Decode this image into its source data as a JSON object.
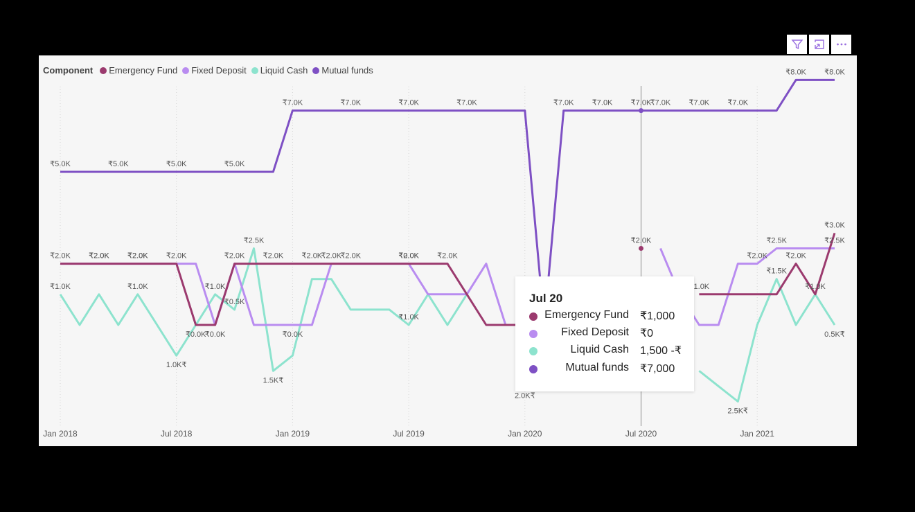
{
  "toolbar": {
    "icons": [
      "filter-icon",
      "focus-mode-icon",
      "more-options-icon"
    ]
  },
  "legend": {
    "title": "Component"
  },
  "tooltip": {
    "title": "Jul 20",
    "rows": [
      {
        "name": "Emergency Fund",
        "value": "₹1,000",
        "color": "#9b3a6e"
      },
      {
        "name": "Fixed Deposit",
        "value": "₹0",
        "color": "#b98cf0"
      },
      {
        "name": "Liquid Cash",
        "value": "1,500 -₹",
        "color": "#8de3ce"
      },
      {
        "name": "Mutual funds",
        "value": "₹7,000",
        "color": "#7e50c4"
      }
    ]
  },
  "chart_data": {
    "type": "line",
    "x_ticks": [
      "Jan 2018",
      "Jul 2018",
      "Jan 2019",
      "Jul 2019",
      "Jan 2020",
      "Jul 2020",
      "Jan 2021"
    ],
    "x_start": "2018-01",
    "x_end": "2021-01",
    "legend_position": "top-left",
    "grid": "vertical dotted",
    "crosshair": "Jul 2020",
    "series": [
      {
        "name": "Emergency Fund",
        "color": "#9b3a6e",
        "values": [
          2000,
          2000,
          2000,
          2000,
          2000,
          2000,
          2000,
          0,
          0,
          2000,
          2000,
          2000,
          2000,
          2000,
          2000,
          2000,
          2000,
          2000,
          2000,
          2000,
          2000,
          1000,
          0,
          0,
          0,
          null,
          null,
          null,
          null,
          null,
          2500,
          null,
          null,
          1000,
          1000,
          1000,
          1000,
          1000,
          2000,
          1000,
          3000
        ]
      },
      {
        "name": "Fixed Deposit",
        "color": "#b98cf0",
        "values": [
          2000,
          2000,
          2000,
          2000,
          2000,
          2000,
          2000,
          2000,
          0,
          2000,
          0,
          0,
          0,
          0,
          2000,
          2000,
          2000,
          2000,
          2000,
          1000,
          1000,
          1000,
          2000,
          0,
          0,
          null,
          null,
          null,
          null,
          null,
          null,
          2500,
          1000,
          0,
          0,
          2000,
          2000,
          2500,
          2500,
          2500,
          2500
        ]
      },
      {
        "name": "Liquid Cash",
        "color": "#8de3ce",
        "values": [
          1000,
          0,
          1000,
          0,
          1000,
          0,
          -1000,
          0,
          1000,
          500,
          2500,
          -1500,
          -1000,
          1500,
          1500,
          500,
          500,
          500,
          0,
          1000,
          0,
          1000,
          null,
          null,
          -2000,
          null,
          null,
          null,
          null,
          null,
          null,
          null,
          null,
          -1500,
          -2000,
          -2500,
          0,
          1500,
          0,
          1000,
          0
        ]
      },
      {
        "name": "Mutual funds",
        "color": "#7e50c4",
        "values": [
          5000,
          5000,
          5000,
          5000,
          5000,
          5000,
          5000,
          5000,
          5000,
          5000,
          5000,
          5000,
          7000,
          7000,
          7000,
          7000,
          7000,
          7000,
          7000,
          7000,
          7000,
          7000,
          7000,
          7000,
          7000,
          0,
          7000,
          7000,
          7000,
          7000,
          7000,
          7000,
          7000,
          7000,
          7000,
          7000,
          7000,
          7000,
          8000,
          8000,
          8000
        ]
      }
    ],
    "data_labels": [
      {
        "series": 0,
        "i": 0,
        "text": "₹2.0K"
      },
      {
        "series": 0,
        "i": 2,
        "text": "₹2.0K"
      },
      {
        "series": 0,
        "i": 4,
        "text": "₹2.0K"
      },
      {
        "series": 0,
        "i": 6,
        "text": "₹2.0K"
      },
      {
        "series": 0,
        "i": 7,
        "text": "₹0.0K"
      },
      {
        "series": 0,
        "i": 9,
        "text": "₹2.0K"
      },
      {
        "series": 0,
        "i": 11,
        "text": "₹2.0K"
      },
      {
        "series": 0,
        "i": 13,
        "text": "₹2.0K"
      },
      {
        "series": 0,
        "i": 15,
        "text": "₹2.0K"
      },
      {
        "series": 0,
        "i": 18,
        "text": "₹2.0K"
      },
      {
        "series": 0,
        "i": 20,
        "text": "₹2.0K"
      },
      {
        "series": 0,
        "i": 30,
        "text": "₹2.0K"
      },
      {
        "series": 0,
        "i": 31,
        "text": "₹2.0K"
      },
      {
        "series": 0,
        "i": 33,
        "text": "₹1.0K"
      },
      {
        "series": 0,
        "i": 38,
        "text": "₹2.0K"
      },
      {
        "series": 0,
        "i": 39,
        "text": "₹1.0K"
      },
      {
        "series": 0,
        "i": 40,
        "text": "₹3.0K"
      },
      {
        "series": 1,
        "i": 2,
        "text": "₹2.0K"
      },
      {
        "series": 1,
        "i": 4,
        "text": "₹2.0K"
      },
      {
        "series": 1,
        "i": 8,
        "text": "₹0.0K"
      },
      {
        "series": 1,
        "i": 12,
        "text": "₹0.0K"
      },
      {
        "series": 1,
        "i": 14,
        "text": "₹2.0K"
      },
      {
        "series": 1,
        "i": 18,
        "text": "₹0.0K"
      },
      {
        "series": 1,
        "i": 36,
        "text": "₹2.0K"
      },
      {
        "series": 1,
        "i": 37,
        "text": "₹2.5K"
      },
      {
        "series": 1,
        "i": 40,
        "text": "₹2.5K"
      },
      {
        "series": 2,
        "i": 0,
        "text": "₹1.0K"
      },
      {
        "series": 2,
        "i": 4,
        "text": "₹1.0K"
      },
      {
        "series": 2,
        "i": 6,
        "text": "1.0K₹"
      },
      {
        "series": 2,
        "i": 8,
        "text": "₹1.0K"
      },
      {
        "series": 2,
        "i": 9,
        "text": "₹0.5K"
      },
      {
        "series": 2,
        "i": 10,
        "text": "₹2.5K"
      },
      {
        "series": 2,
        "i": 11,
        "text": "1.5K₹"
      },
      {
        "series": 2,
        "i": 18,
        "text": "₹1.0K"
      },
      {
        "series": 2,
        "i": 24,
        "text": "2.0K₹"
      },
      {
        "series": 2,
        "i": 35,
        "text": "2.5K₹"
      },
      {
        "series": 2,
        "i": 37,
        "text": "₹1.5K"
      },
      {
        "series": 2,
        "i": 40,
        "text": "0.5K₹"
      },
      {
        "series": 3,
        "i": 0,
        "text": "₹5.0K"
      },
      {
        "series": 3,
        "i": 3,
        "text": "₹5.0K"
      },
      {
        "series": 3,
        "i": 6,
        "text": "₹5.0K"
      },
      {
        "series": 3,
        "i": 9,
        "text": "₹5.0K"
      },
      {
        "series": 3,
        "i": 12,
        "text": "₹7.0K"
      },
      {
        "series": 3,
        "i": 15,
        "text": "₹7.0K"
      },
      {
        "series": 3,
        "i": 18,
        "text": "₹7.0K"
      },
      {
        "series": 3,
        "i": 21,
        "text": "₹7.0K"
      },
      {
        "series": 3,
        "i": 26,
        "text": "₹7.0K"
      },
      {
        "series": 3,
        "i": 28,
        "text": "₹7.0K"
      },
      {
        "series": 3,
        "i": 30,
        "text": "₹7.0K"
      },
      {
        "series": 3,
        "i": 31,
        "text": "₹7.0K"
      },
      {
        "series": 3,
        "i": 33,
        "text": "₹7.0K"
      },
      {
        "series": 3,
        "i": 35,
        "text": "₹7.0K"
      },
      {
        "series": 3,
        "i": 38,
        "text": "₹8.0K"
      },
      {
        "series": 3,
        "i": 40,
        "text": "₹8.0K"
      }
    ]
  }
}
